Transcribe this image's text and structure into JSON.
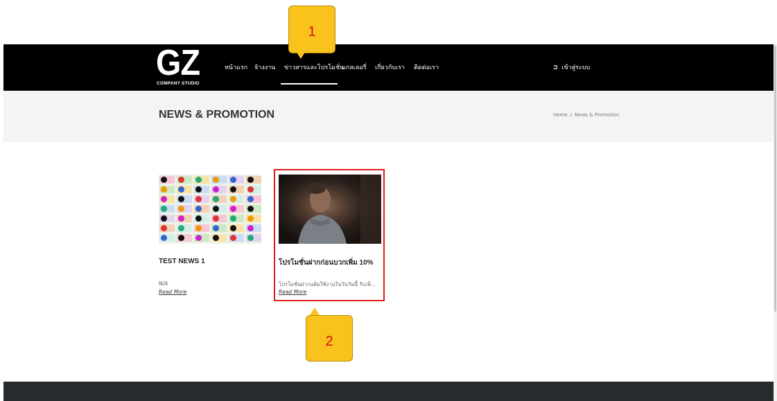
{
  "brand": {
    "logo_text": "GZ",
    "logo_subtext": "COMPANY STUDIO"
  },
  "nav": {
    "items": [
      {
        "label": "หน้าแรก"
      },
      {
        "label": "จ้างงาน"
      },
      {
        "label": "ข่าวสารและโปรโมชั่น"
      },
      {
        "label": "แกลเลอรี่"
      },
      {
        "label": "เกี่ยวกับเรา"
      },
      {
        "label": "ติดต่อเรา"
      }
    ],
    "login_label": "เข้าสู่ระบบ",
    "login_icon": "sign-in-icon"
  },
  "page": {
    "title": "NEWS & PROMOTION",
    "breadcrumb": [
      {
        "label": "Home"
      },
      {
        "label": "News & Promotion"
      }
    ],
    "breadcrumb_separator": "/"
  },
  "posts": [
    {
      "title": "TEST NEWS 1",
      "excerpt": "N/A",
      "read_more": "Read More"
    },
    {
      "title": "โปรโมชั่นฝากก่อนบวกเพิ่ม 10%",
      "excerpt": "โปรโมชั่นฝากแต้มใช้งานในวันวันนี้ รับเพิ่...",
      "read_more": "Read More"
    }
  ],
  "annotations": {
    "callout_1": "1",
    "callout_2": "2"
  },
  "colors": {
    "header_bg": "#000000",
    "title_band_bg": "#f4f4f4",
    "highlight": "#e01b1b",
    "callout_bg": "#f9c21c",
    "callout_text": "#d01010",
    "footer_bg": "#262b2f"
  }
}
